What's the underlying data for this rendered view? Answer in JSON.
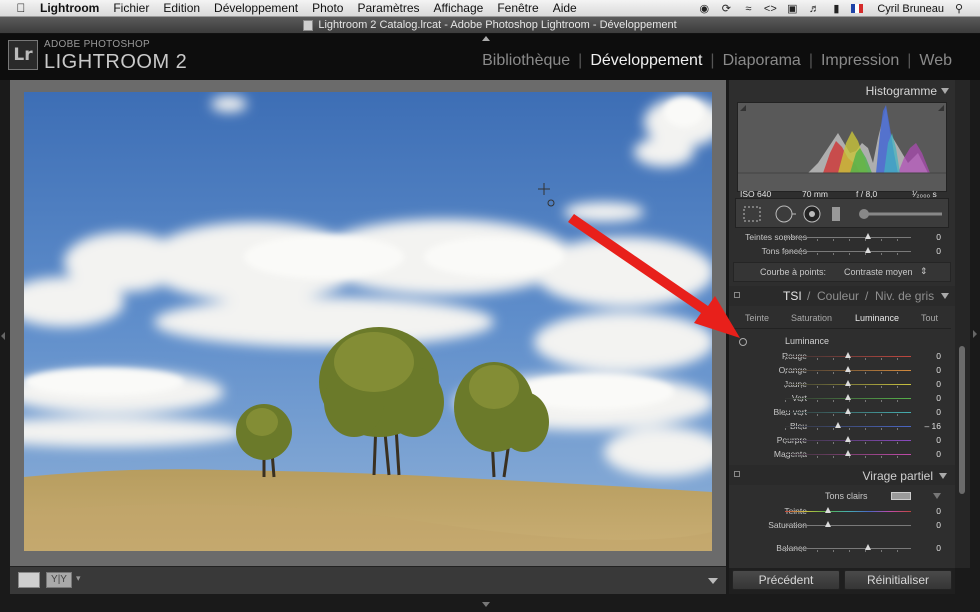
{
  "menubar": {
    "items": [
      "Lightroom",
      "Fichier",
      "Edition",
      "Développement",
      "Photo",
      "Paramètres",
      "Affichage",
      "Fenêtre",
      "Aide"
    ],
    "user": "Cyril Bruneau",
    "icons": [
      "apple-icon",
      "camera-icon",
      "time-machine-icon",
      "wifi-icon",
      "code-icon",
      "display-icon",
      "volume-icon",
      "battery-icon",
      "flag-icon"
    ]
  },
  "window": {
    "title": "Lightroom 2 Catalog.lrcat - Adobe Photoshop Lightroom - Développement"
  },
  "identity": {
    "logo": "Lr",
    "small": "ADOBE PHOTOSHOP",
    "big": "LIGHTROOM 2"
  },
  "modules": [
    {
      "label": "Bibliothèque",
      "active": false
    },
    {
      "label": "Développement",
      "active": true
    },
    {
      "label": "Diaporama",
      "active": false
    },
    {
      "label": "Impression",
      "active": false
    },
    {
      "label": "Web",
      "active": false
    }
  ],
  "histogram": {
    "title": "Histogramme",
    "iso": "ISO 640",
    "focal": "70 mm",
    "aperture": "f / 8,0",
    "shutter": "¹⁄₂₀₀₀ s"
  },
  "tone": {
    "rows": [
      {
        "label": "Teintes sombres",
        "value": "0"
      },
      {
        "label": "Tons foncés",
        "value": "0"
      }
    ],
    "curve_label": "Courbe à points:",
    "curve_value": "Contraste moyen"
  },
  "hsl": {
    "tabs": [
      "TSI",
      "Couleur",
      "Niv. de gris"
    ],
    "subtabs": [
      "Teinte",
      "Saturation",
      "Luminance",
      "Tout"
    ],
    "active_subtab": "Luminance",
    "section": "Luminance",
    "rows": [
      {
        "label": "Rouge",
        "value": "0",
        "level": 0,
        "color": "#c0473f"
      },
      {
        "label": "Orange",
        "value": "0",
        "level": 0,
        "color": "#d38a3d"
      },
      {
        "label": "Jaune",
        "value": "0",
        "level": 0,
        "color": "#c9c23f"
      },
      {
        "label": "Vert",
        "value": "0",
        "level": 0,
        "color": "#56b04a"
      },
      {
        "label": "Bleu vert",
        "value": "0",
        "level": 0,
        "color": "#45aeb0"
      },
      {
        "label": "Bleu",
        "value": "– 16",
        "level": -16,
        "color": "#4a66c4"
      },
      {
        "label": "Pourpre",
        "value": "0",
        "level": 0,
        "color": "#8a4ac0"
      },
      {
        "label": "Magenta",
        "value": "0",
        "level": 0,
        "color": "#c04aa9"
      }
    ]
  },
  "split": {
    "title": "Virage partiel",
    "highlights": "Tons clairs",
    "rows": [
      {
        "label": "Teinte",
        "value": "0"
      },
      {
        "label": "Saturation",
        "value": "0"
      }
    ],
    "balance_label": "Balance",
    "balance_value": "0"
  },
  "buttons": {
    "previous": "Précédent",
    "reset": "Réinitialiser"
  },
  "toolbar": {
    "yy": "Y|Y"
  },
  "colors": {
    "annotation_arrow": "#e8201b"
  }
}
